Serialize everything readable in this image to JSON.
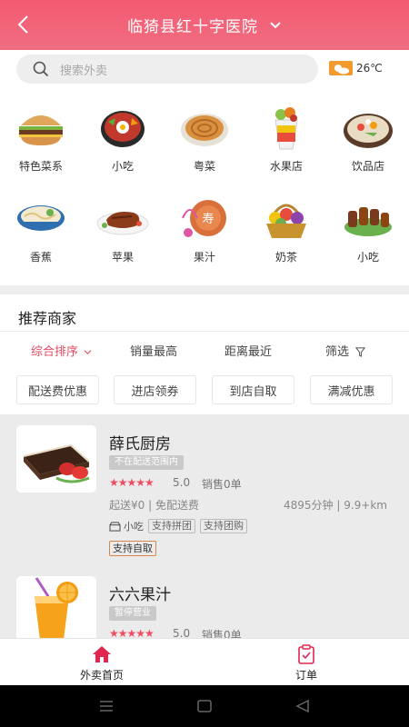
{
  "header": {
    "title": "临猗县红十字医院"
  },
  "search": {
    "placeholder": "搜索外卖"
  },
  "weather": {
    "temp": "26℃"
  },
  "categories": [
    {
      "label": "特色菜系",
      "icon": "burger-icon"
    },
    {
      "label": "小吃",
      "icon": "bibimbap-icon"
    },
    {
      "label": "粤菜",
      "icon": "pancake-icon"
    },
    {
      "label": "水果店",
      "icon": "fruit-cup-icon"
    },
    {
      "label": "饮品店",
      "icon": "hotpot-icon"
    },
    {
      "label": "香蕉",
      "icon": "noodle-bowl-icon"
    },
    {
      "label": "苹果",
      "icon": "steak-icon"
    },
    {
      "label": "果汁",
      "icon": "cake-icon"
    },
    {
      "label": "奶茶",
      "icon": "fruit-basket-icon"
    },
    {
      "label": "小吃",
      "icon": "skewers-icon"
    }
  ],
  "section": {
    "title": "推荐商家"
  },
  "sort": {
    "tabs": [
      "综合排序",
      "销量最高",
      "距离最近",
      "筛选"
    ]
  },
  "filters": [
    "配送费优惠",
    "进店领券",
    "到店自取",
    "满减优惠"
  ],
  "merchants": [
    {
      "name": "薛氏厨房",
      "status": "不在配送范围内",
      "stars": "★★★★★",
      "score": "5.0",
      "sales": "销售0单",
      "delivery": "起送¥0 | 免配送费",
      "distance": "4895分钟 | 9.9+km",
      "category": "小吃",
      "tags": [
        "支持拼团",
        "支持团购"
      ],
      "highlight": "支持自取"
    },
    {
      "name": "六六果汁",
      "status": "暂停营业",
      "stars": "★★★★★",
      "score": "5.0",
      "sales": "销售0单"
    }
  ],
  "bottom_nav": [
    {
      "label": "外卖首页",
      "active": true
    },
    {
      "label": "订单",
      "active": false
    }
  ],
  "colors": {
    "brand": "#f35a72",
    "active_text": "#e24a62",
    "accent_orange": "#d8844e"
  }
}
